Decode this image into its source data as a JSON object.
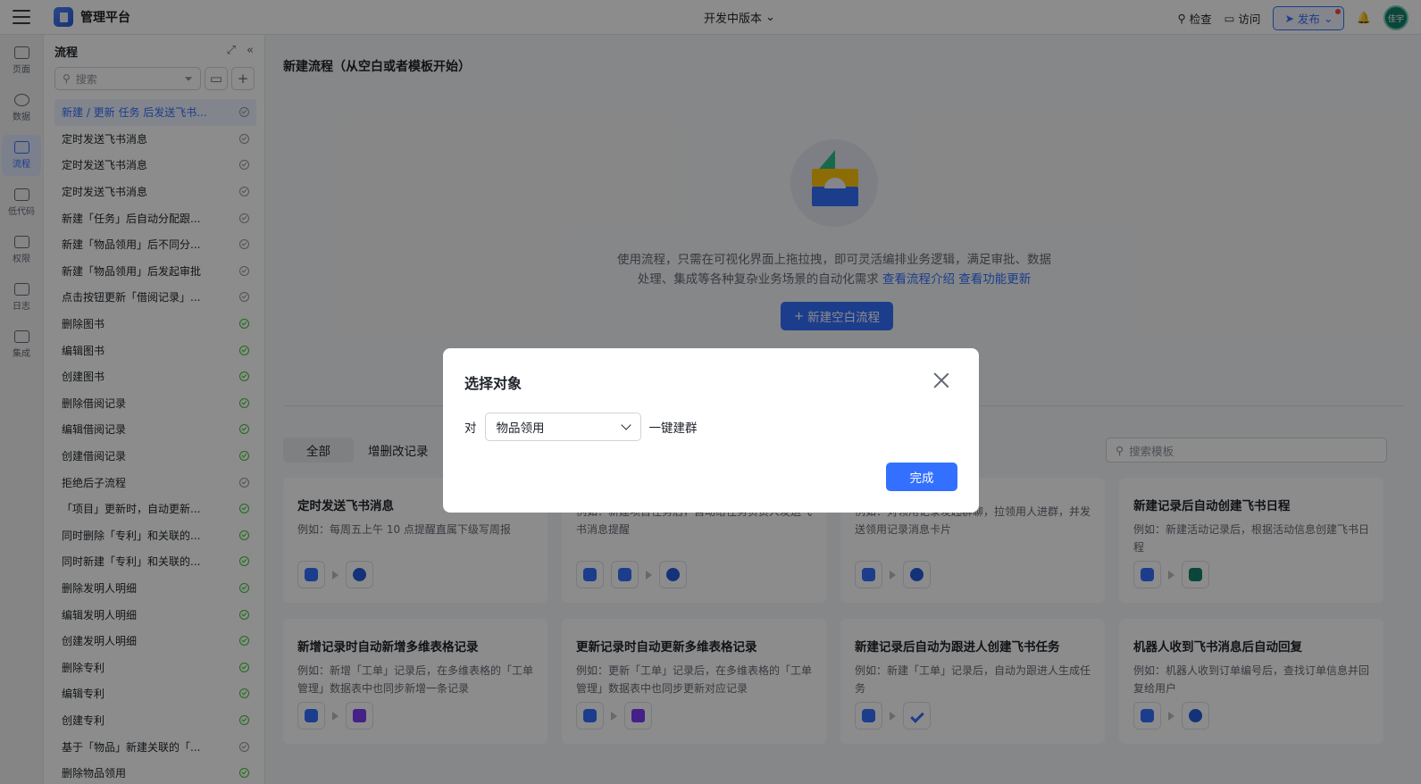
{
  "app": {
    "name": "管理平台",
    "version": "开发中版本"
  },
  "topbar": {
    "check": "检查",
    "visit": "访问",
    "publish": "发布",
    "avatar": "佳宇"
  },
  "rail": [
    "页面",
    "数据",
    "流程",
    "低代码",
    "权限",
    "日志",
    "集成"
  ],
  "panel": {
    "title": "流程",
    "search_placeholder": "搜索",
    "items": [
      {
        "label": "新建 / 更新 任务 后发送飞书...",
        "status": "off",
        "selected": true
      },
      {
        "label": "定时发送飞书消息",
        "status": "off"
      },
      {
        "label": "定时发送飞书消息",
        "status": "off"
      },
      {
        "label": "定时发送飞书消息",
        "status": "off"
      },
      {
        "label": "新建「任务」后自动分配跟...",
        "status": "off"
      },
      {
        "label": "新建「物品领用」后不同分...",
        "status": "off"
      },
      {
        "label": "新建「物品领用」后发起审批",
        "status": "off"
      },
      {
        "label": "点击按钮更新「借阅记录」...",
        "status": "off"
      },
      {
        "label": "删除图书",
        "status": "on"
      },
      {
        "label": "编辑图书",
        "status": "on"
      },
      {
        "label": "创建图书",
        "status": "on"
      },
      {
        "label": "删除借阅记录",
        "status": "on"
      },
      {
        "label": "编辑借阅记录",
        "status": "on"
      },
      {
        "label": "创建借阅记录",
        "status": "on"
      },
      {
        "label": "拒绝后子流程",
        "status": "off"
      },
      {
        "label": "「项目」更新时，自动更新...",
        "status": "on"
      },
      {
        "label": "同时删除「专利」和关联的...",
        "status": "on"
      },
      {
        "label": "同时新建「专利」和关联的...",
        "status": "on"
      },
      {
        "label": "删除发明人明细",
        "status": "on"
      },
      {
        "label": "编辑发明人明细",
        "status": "on"
      },
      {
        "label": "创建发明人明细",
        "status": "on"
      },
      {
        "label": "删除专利",
        "status": "on"
      },
      {
        "label": "编辑专利",
        "status": "on"
      },
      {
        "label": "创建专利",
        "status": "on"
      },
      {
        "label": "基于「物品」新建关联的「...",
        "status": "off"
      },
      {
        "label": "删除物品领用",
        "status": "on"
      }
    ]
  },
  "main": {
    "title": "新建流程（从空白或者模板开始）",
    "intro": "使用流程，只需在可视化界面上拖拉拽，即可灵活编排业务逻辑，满足审批、数据处理、集成等各种复杂业务场景的自动化需求",
    "link1": "查看流程介绍",
    "link2": "查看功能更新",
    "new_blank": "新建空白流程",
    "tabs": [
      "全部",
      "增删改记录"
    ],
    "search_placeholder": "搜索模板",
    "cards": [
      {
        "title": "定时发送飞书消息",
        "desc": "例如：每周五上午 10 点提醒直属下级写周报",
        "icons": [
          "alarm-clock-icon",
          "feishu-message-icon"
        ]
      },
      {
        "title": "",
        "desc": "例如：新建项目任务后，自动给任务负责人发送飞书消息提醒",
        "icons": [
          "record-add-icon",
          "record-query-icon",
          "feishu-message-icon"
        ]
      },
      {
        "title": "",
        "desc": "例如：对领用记录发起群聊，拉领用人进群，并发送领用记录消息卡片",
        "icons": [
          "click-button-icon",
          "group-chat-icon"
        ]
      },
      {
        "title": "新建记录后自动创建飞书日程",
        "desc": "例如：新建活动记录后，根据活动信息创建飞书日程",
        "icons": [
          "record-add-icon",
          "calendar-icon"
        ]
      },
      {
        "title": "新增记录时自动新增多维表格记录",
        "desc": "例如：新增「工单」记录后，在多维表格的「工单管理」数据表中也同步新增一条记录",
        "icons": [
          "record-add-icon",
          "bitable-icon"
        ]
      },
      {
        "title": "更新记录时自动更新多维表格记录",
        "desc": "例如：更新「工单」记录后，在多维表格的「工单管理」数据表中也同步更新对应记录",
        "icons": [
          "record-update-icon",
          "bitable-icon"
        ]
      },
      {
        "title": "新建记录后自动为跟进人创建飞书任务",
        "desc": "例如：新建「工单」记录后，自动为跟进人生成任务",
        "icons": [
          "record-add-icon",
          "task-check-icon"
        ]
      },
      {
        "title": "机器人收到飞书消息后自动回复",
        "desc": "例如：机器人收到订单编号后，查找订单信息并回复给用户",
        "icons": [
          "robot-icon",
          "feishu-message-icon"
        ]
      }
    ]
  },
  "modal": {
    "title": "选择对象",
    "prefix": "对",
    "selected": "物品领用",
    "suffix": "一键建群",
    "done": "完成"
  }
}
